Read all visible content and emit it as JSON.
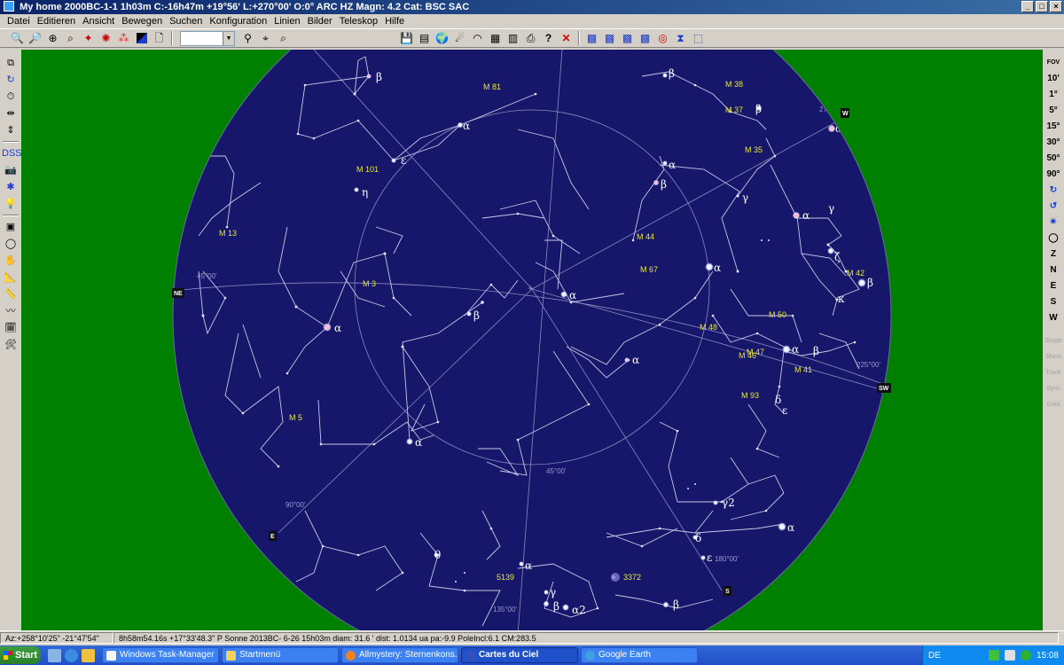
{
  "window": {
    "title": "My home 2000BC-1-1   1h03m C:-16h47m +19°56' L:+270°00' O:0° ARC HZ  Magn: 4.2 Cat: BSC SAC",
    "minimize": "_",
    "maximize": "□",
    "close": "×"
  },
  "menu": [
    "Datei",
    "Editieren",
    "Ansicht",
    "Bewegen",
    "Suchen",
    "Konfiguration",
    "Linien",
    "Bilder",
    "Teleskop",
    "Hilfe"
  ],
  "toolbar": {
    "search_value": "",
    "combo_arrow": "▼"
  },
  "right_toolbar": {
    "fov_top": "FOV",
    "fov": [
      "10'",
      "1°",
      "5°",
      "15°",
      "30°",
      "50°",
      "90°"
    ],
    "directions": [
      "Z",
      "N",
      "E",
      "S",
      "W"
    ],
    "telescope": [
      "Scope",
      "Show",
      "Track",
      "Sync",
      "Goto"
    ]
  },
  "sky": {
    "horizon": [
      "NE",
      "E",
      "S",
      "SW",
      "W"
    ],
    "azimuth_labels": [
      "45°00'",
      "90°00'",
      "135°00'",
      "180°00'",
      "225°00'",
      "270°00'",
      "45°00'"
    ],
    "objects": {
      "m81": "M 81",
      "m101": "M 101",
      "m13": "M 13",
      "m3": "M 3",
      "m5": "M 5",
      "m38": "M 38",
      "m37": "M 37",
      "m35": "M 35",
      "m44": "M 44",
      "m67": "M 67",
      "m42": "M 42",
      "m50": "M 50",
      "m48": "M 48",
      "m47": "M 47",
      "m46": "M 46",
      "m41": "M 41",
      "m93": "M 93",
      "ngc5139": "5139",
      "ngc3372": "3372"
    },
    "stars": {
      "b_uma": "β",
      "a_uma": "α",
      "e_uma": "ε",
      "h_uma": "η",
      "b_aur": "β",
      "a_gem": "α",
      "b_gem": "β",
      "g_gem": "γ",
      "a_cmi": "α",
      "a_ori": "α",
      "g_ori": "γ",
      "b_ori": "β",
      "k_ori": "κ",
      "a_ori2": "α",
      "z_ori": "ζ",
      "a_leo": "α",
      "b_leo": "β",
      "a_boo": "α",
      "a_vir": "α",
      "a_hya": "α",
      "a_cma": "α",
      "b_cma": "β",
      "d_cma": "δ",
      "e_cma": "ε",
      "a_aur": "α",
      "g_vel": "γ2",
      "d_vel": "δ",
      "e_car": "ε",
      "a_car": "α",
      "th_cen": "θ",
      "g_cru": "γ",
      "b_cru": "β",
      "a_cru": "α2",
      "b_cen": "β",
      "a_cen": "β"
    }
  },
  "status": {
    "pos": "Az:+258°10'25\" -21°47'54\"",
    "info": "8h58m54.16s +17°33'48.3\"  P Sonne   2013BC- 6-26  15h03m diam: 31.6 ' dist: 1.0134 ua pa:-9.9 PoleIncl:6.1 CM:283.5"
  },
  "taskbar": {
    "start": "Start",
    "tasks": [
      "Windows Task-Manager",
      "Startmenü",
      "Allmystery: Sternenkons...",
      "Cartes du Ciel",
      "Google Earth"
    ],
    "lang": "DE",
    "clock": "15:08"
  }
}
